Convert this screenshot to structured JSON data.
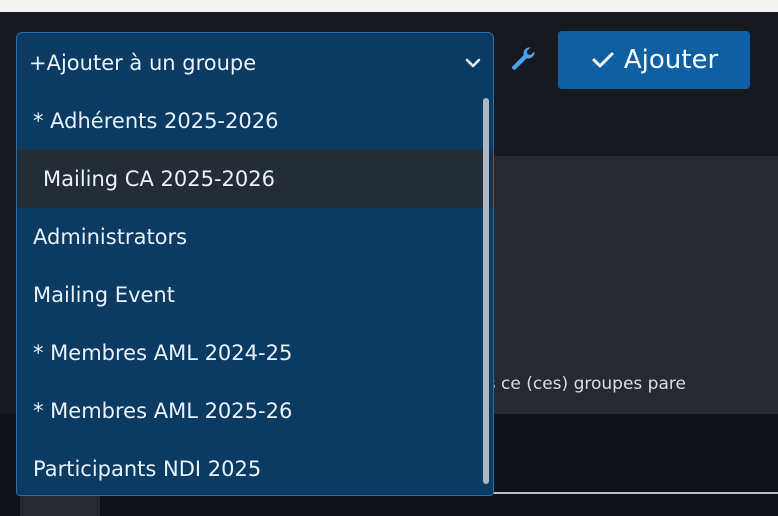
{
  "group_select": {
    "selected_label": "Ajouter à un groupe",
    "options": [
      "* Adhérents 2025-2026",
      "Mailing CA 2025-2026",
      "Administrators",
      "Mailing Event",
      "* Membres AML 2024-25",
      "* Membres AML 2025-26",
      "Participants NDI 2025"
    ],
    "highlighted_index": 1
  },
  "toolbar": {
    "add_label": "Ajouter"
  },
  "background": {
    "partial_text": "ns ce (ces) groupes pare"
  },
  "icons": {
    "plus": "plus-icon",
    "chevron": "chevron-down-icon",
    "wrench": "wrench-icon",
    "check": "check-icon"
  },
  "colors": {
    "select_bg": "#0b3b63",
    "highlight_bg": "#242c35",
    "button_bg": "#0f5fa2",
    "wrench": "#4aa3f0"
  }
}
